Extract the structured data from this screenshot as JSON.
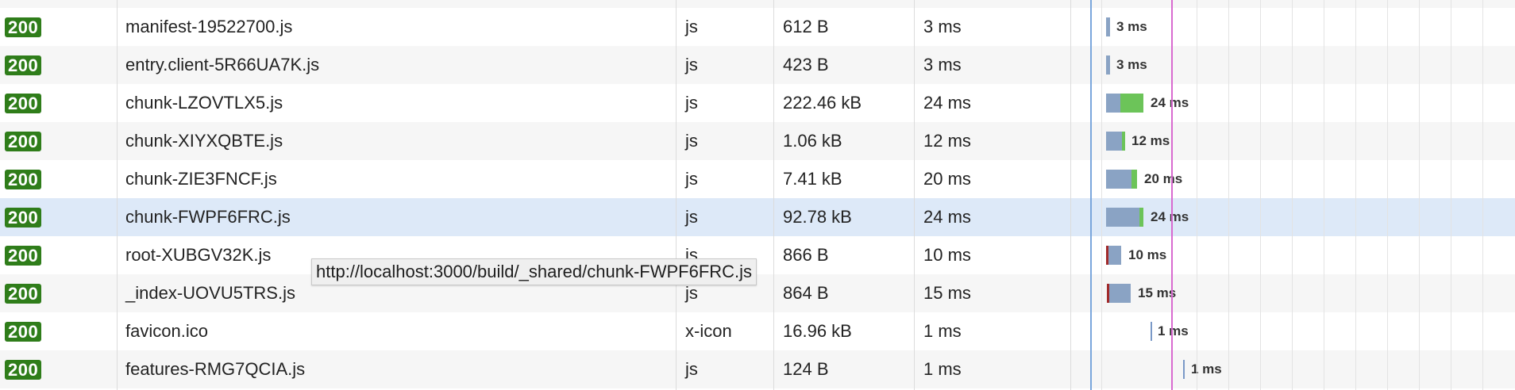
{
  "requests": [
    {
      "status": "200",
      "name": "manifest-19522700.js",
      "type": "js",
      "size": "612 B",
      "time": "3 ms",
      "timeline_label": "3 ms"
    },
    {
      "status": "200",
      "name": "entry.client-5R66UA7K.js",
      "type": "js",
      "size": "423 B",
      "time": "3 ms",
      "timeline_label": "3 ms"
    },
    {
      "status": "200",
      "name": "chunk-LZOVTLX5.js",
      "type": "js",
      "size": "222.46 kB",
      "time": "24 ms",
      "timeline_label": "24 ms"
    },
    {
      "status": "200",
      "name": "chunk-XIYXQBTE.js",
      "type": "js",
      "size": "1.06 kB",
      "time": "12 ms",
      "timeline_label": "12 ms"
    },
    {
      "status": "200",
      "name": "chunk-ZIE3FNCF.js",
      "type": "js",
      "size": "7.41 kB",
      "time": "20 ms",
      "timeline_label": "20 ms"
    },
    {
      "status": "200",
      "name": "chunk-FWPF6FRC.js",
      "type": "js",
      "size": "92.78 kB",
      "time": "24 ms",
      "timeline_label": "24 ms",
      "selected": true
    },
    {
      "status": "200",
      "name": "root-XUBGV32K.js",
      "type": "js",
      "size": "866 B",
      "time": "10 ms",
      "timeline_label": "10 ms"
    },
    {
      "status": "200",
      "name": "_index-UOVU5TRS.js",
      "type": "js",
      "size": "864 B",
      "time": "15 ms",
      "timeline_label": "15 ms"
    },
    {
      "status": "200",
      "name": "favicon.ico",
      "type": "x-icon",
      "size": "16.96 kB",
      "time": "1 ms",
      "timeline_label": "1 ms"
    },
    {
      "status": "200",
      "name": "features-RMG7QCIA.js",
      "type": "js",
      "size": "124 B",
      "time": "1 ms",
      "timeline_label": "1 ms"
    }
  ],
  "tooltip": {
    "url": "http://localhost:3000/build/_shared/chunk-FWPF6FRC.js"
  },
  "colors": {
    "status_badge": "#2f7d1a",
    "selected_row": "#dde9f8",
    "waiting_segment": "#8aa3c4",
    "receiving_segment": "#6cc459",
    "blocked_segment": "#a12a2a",
    "dom_content_loaded_marker": "#7aa6dc",
    "load_marker": "#d86ad0"
  }
}
